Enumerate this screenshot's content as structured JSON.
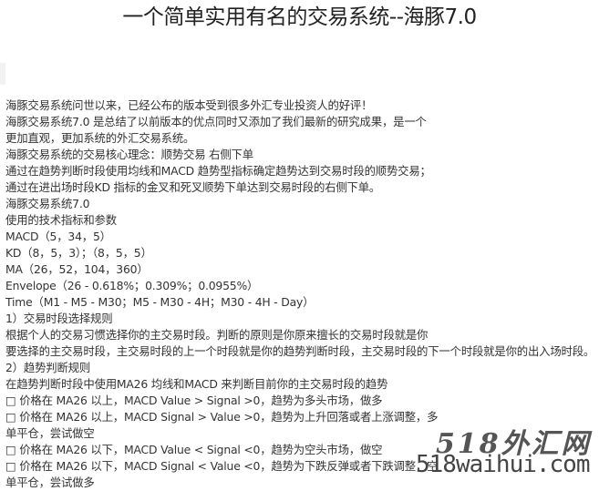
{
  "article": {
    "title": "一个简单实用有名的交易系统--海豚7.0",
    "lines": [
      "海豚交易系统问世以来，已经公布的版本受到很多外汇专业投资人的好评！",
      "海豚交易系统7.0 是总结了以前版本的优点同时又添加了我们最新的研究成果，是一个",
      "更加直观，更加系统的外汇交易系统。",
      "海豚交易系统的交易核心理念：顺势交易 右侧下单",
      "通过在趋势判断时段使用均线和MACD 趋势型指标确定趋势达到交易时段的顺势交易；",
      "通过在进出场时段KD 指标的金叉和死叉顺势下单达到交易时段的右侧下单。",
      "海豚交易系统7.0",
      "使用的技术指标和参数",
      "MACD（5，34，5）",
      "KD（8，5，3）；（8，5，5）",
      "MA（26，52，104，360）",
      "Envelope（26 - 0.618%；0.309%；0.0955%）",
      "Time（M1 - M5 - M30；M5 - M30 - 4H；M30 - 4H - Day）",
      "1）交易时段选择规则",
      "根据个人的交易习惯选择你的主交易时段。判断的原则是你原来擅长的交易时段就是你",
      "要选择的主交易时段，主交易时段的上一个时段就是你的趋势判断时段，主交易时段的下一个时段就是你的出入场时段。",
      "2）趋势判断规则",
      "在趋势判断时段中使用MA26 均线和MACD 来判断目前你的主交易时段的趋势",
      "□ 价格在 MA26 以上，MACD Value > Signal >0，趋势为多头市场，做多",
      "□ 价格在 MA26 以上，MACD Signal > Value >0，趋势为上升回落或者上涨调整，多",
      "单平仓，尝试做空",
      "□ 价格在 MA26 以下，MACD Value < Signal <0，趋势为空头市场，做空",
      "□ 价格在 MA26 以下，MACD Signal < Value <0，趋势为下跌反弹或者下跌调整，空",
      "单平仓，尝试做多"
    ]
  },
  "watermark": {
    "brand": "518外汇网",
    "url": "518waihui.com"
  }
}
